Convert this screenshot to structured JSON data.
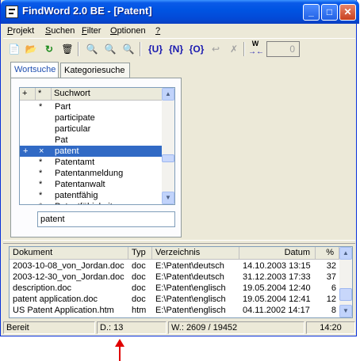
{
  "window": {
    "title": "FindWord 2.0 BE - [Patent]",
    "min_glyph": "_",
    "max_glyph": "□",
    "close_glyph": "✕"
  },
  "menu": [
    {
      "u": "P",
      "rest": "rojekt"
    },
    {
      "u": "S",
      "rest": "uchen"
    },
    {
      "u": "F",
      "rest": "ilter"
    },
    {
      "u": "O",
      "rest": "ptionen"
    },
    {
      "u": "?",
      "rest": ""
    }
  ],
  "toolbar": {
    "new_icon": "📄",
    "open_icon": "📂",
    "refresh_icon": "↻",
    "delete_icon": "🗑",
    "zoom1_icon": "🔍",
    "zoom2_icon": "🔍",
    "zoom3_icon": "🔍",
    "brace_u": "{U}",
    "brace_n": "{N}",
    "brace_o": "{O}",
    "undo_icon": "↩",
    "cancel_icon": "✗",
    "w_label": "W",
    "w_arrows": "→←",
    "counter_value": "0"
  },
  "tabs": [
    "Wortsuche",
    "Kategoriesuche"
  ],
  "wordlist": {
    "headers": [
      "+",
      "*",
      "Suchwort"
    ],
    "rows": [
      {
        "plus": "",
        "star": "*",
        "word": "Part",
        "selected": false
      },
      {
        "plus": "",
        "star": "",
        "word": "participate",
        "selected": false
      },
      {
        "plus": "",
        "star": "",
        "word": "particular",
        "selected": false
      },
      {
        "plus": "",
        "star": "",
        "word": "Pat",
        "selected": false
      },
      {
        "plus": "+",
        "star": "×",
        "word": "patent",
        "selected": true
      },
      {
        "plus": "",
        "star": "*",
        "word": "Patentamt",
        "selected": false
      },
      {
        "plus": "",
        "star": "*",
        "word": "Patentanmeldung",
        "selected": false
      },
      {
        "plus": "",
        "star": "*",
        "word": "Patentanwalt",
        "selected": false
      },
      {
        "plus": "",
        "star": "*",
        "word": "patentfähig",
        "selected": false
      },
      {
        "plus": "",
        "star": "*",
        "word": "Patentfähigkeit",
        "selected": false
      }
    ]
  },
  "search": {
    "value": "patent"
  },
  "results": {
    "headers": [
      "Dokument",
      "Typ",
      "Verzeichnis",
      "Datum",
      "%"
    ],
    "rows": [
      {
        "doc": "2003-10-08_von_Jordan.doc",
        "typ": "doc",
        "dir": "E:\\Patent\\deutsch",
        "date": "14.10.2003 13:15",
        "pct": "32"
      },
      {
        "doc": "2003-12-30_von_Jordan.doc",
        "typ": "doc",
        "dir": "E:\\Patent\\deutsch",
        "date": "31.12.2003 17:33",
        "pct": "37"
      },
      {
        "doc": "description.doc",
        "typ": "doc",
        "dir": "E:\\Patent\\englisch",
        "date": "19.05.2004 12:40",
        "pct": "6"
      },
      {
        "doc": "patent application.doc",
        "typ": "doc",
        "dir": "E:\\Patent\\englisch",
        "date": "19.05.2004 12:41",
        "pct": "12"
      },
      {
        "doc": "US Patent Application.htm",
        "typ": "htm",
        "dir": "E:\\Patent\\englisch",
        "date": "04.11.2002 14:17",
        "pct": "8"
      }
    ]
  },
  "status": {
    "ready": "Bereit",
    "docs": "D.: 13",
    "words": "W.: 2609 / 19452",
    "time": "14:20"
  },
  "colors": {
    "accent": "#316ac5",
    "arrow": "#e00000",
    "title": "#0054e3"
  }
}
